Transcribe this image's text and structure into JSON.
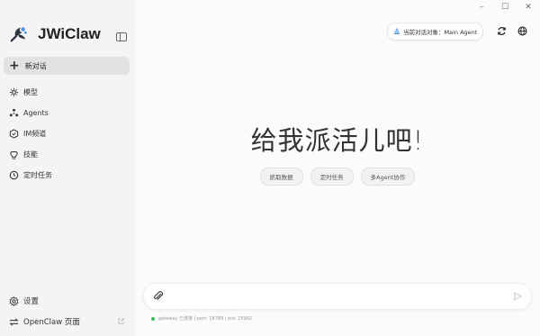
{
  "window": {
    "minimize": "–",
    "maximize": "☐",
    "close": "✕"
  },
  "brand": {
    "name": "JWiClaw"
  },
  "sidebar": {
    "new_chat": "新对话",
    "items": [
      {
        "label": "模型",
        "icon": "model-icon"
      },
      {
        "label": "Agents",
        "icon": "agents-icon"
      },
      {
        "label": "IM频道",
        "icon": "im-channel-icon"
      },
      {
        "label": "技能",
        "icon": "skills-icon"
      },
      {
        "label": "定时任务",
        "icon": "clock-icon"
      }
    ],
    "settings": "设置",
    "openclaw": "OpenClaw 页面"
  },
  "header": {
    "agent_label": "当前对话对象：Main Agent"
  },
  "main": {
    "hero": "给我派活儿吧!",
    "chips": [
      "抓取数据",
      "定时任务",
      "多Agent协作"
    ]
  },
  "input": {
    "placeholder": ""
  },
  "status": {
    "text": "gateway 已连接 | port: 18789 | pid: 25992",
    "color": "#39c25a"
  },
  "colors": {
    "sidebar_bg": "#f4f4f5",
    "main_bg": "#fbfbfb",
    "active_item": "#e2e2e5"
  }
}
